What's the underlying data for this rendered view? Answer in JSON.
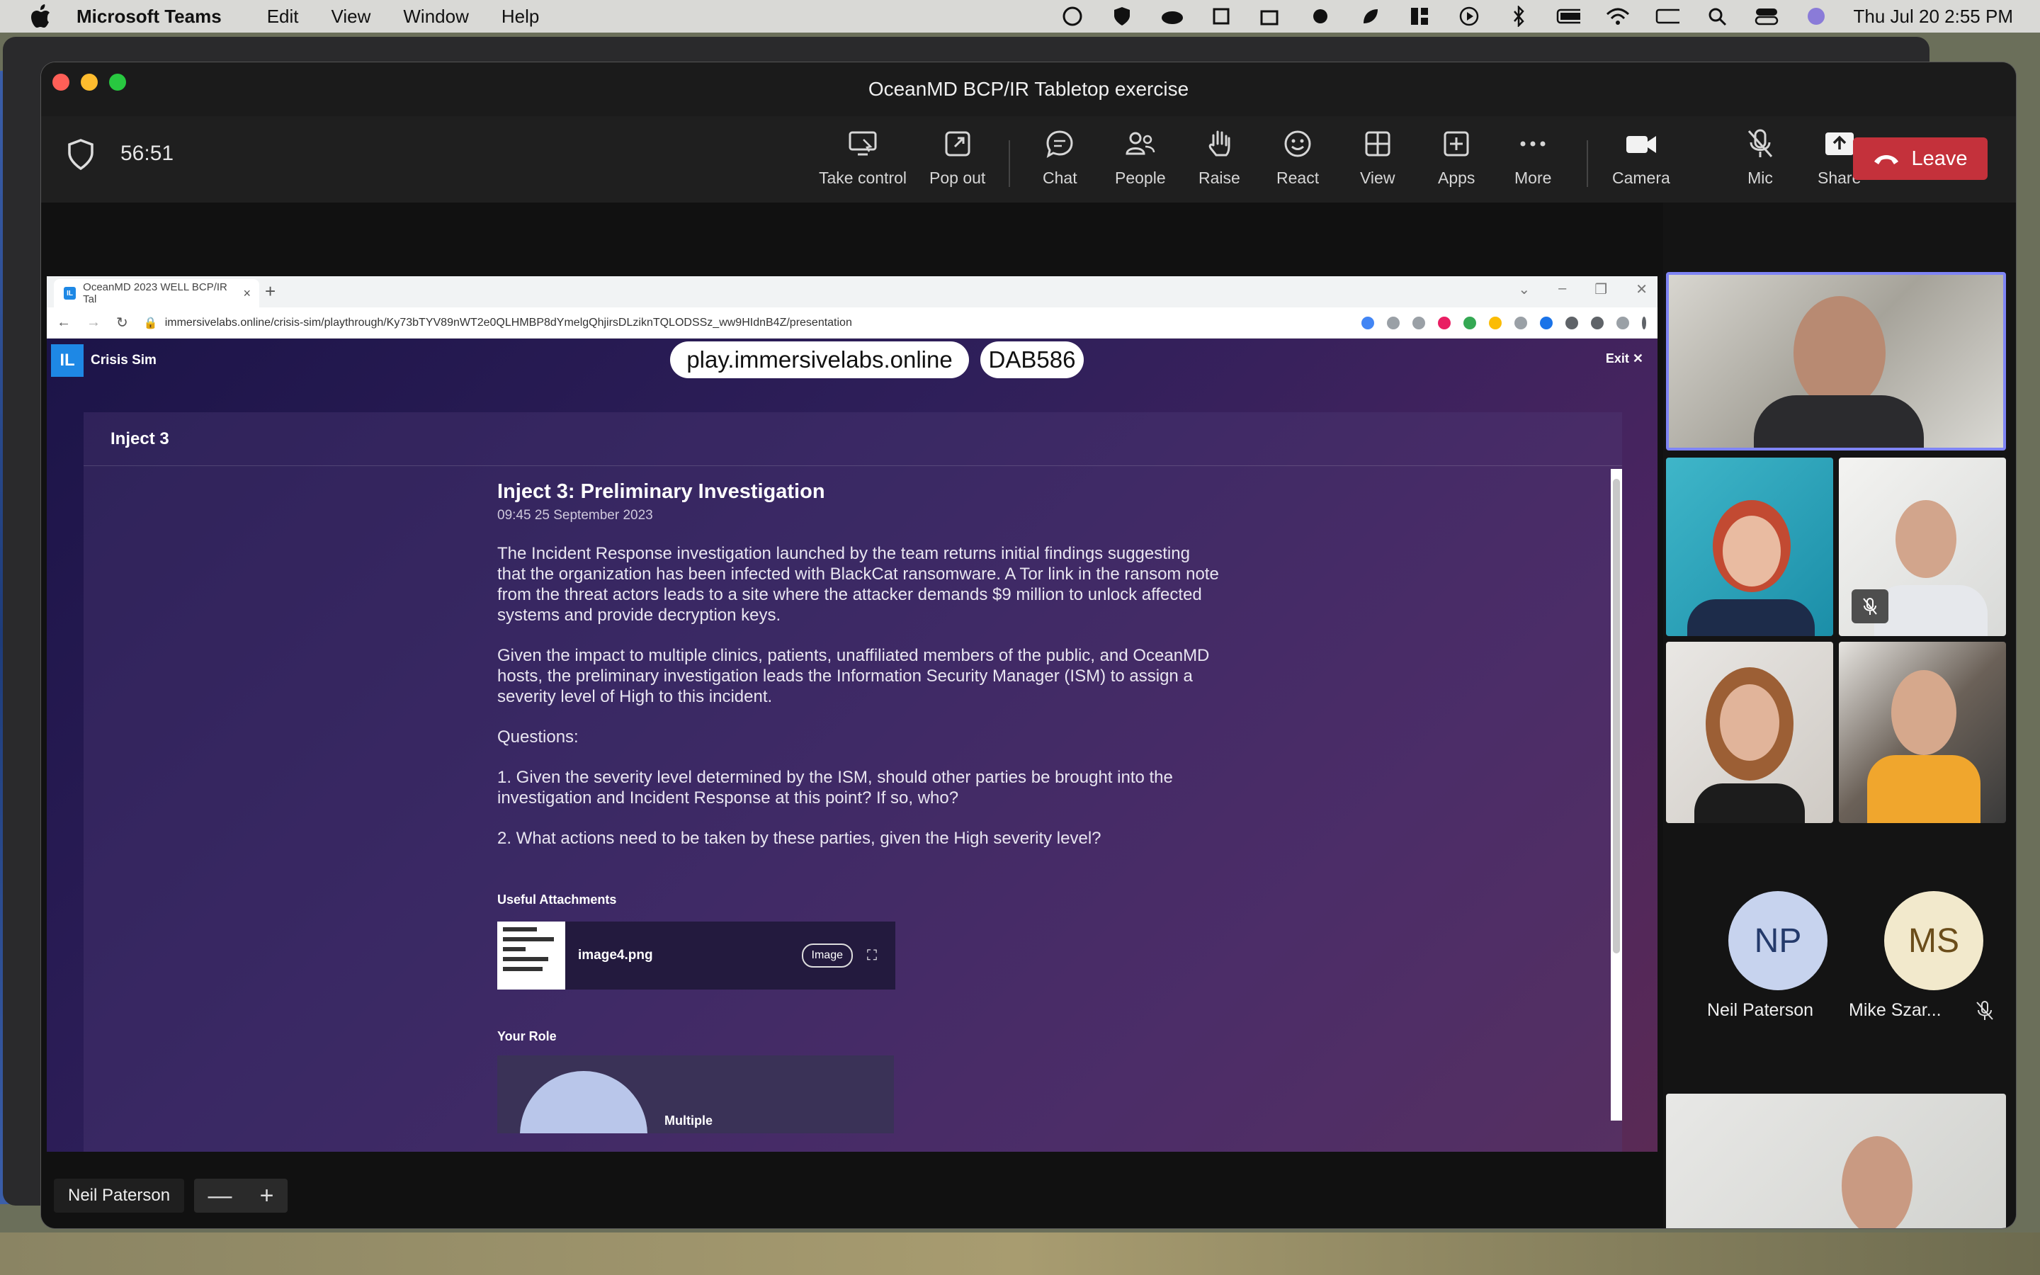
{
  "menubar": {
    "app": "Microsoft Teams",
    "items": [
      "Edit",
      "View",
      "Window",
      "Help"
    ],
    "clock": "Thu Jul 20  2:55 PM"
  },
  "window": {
    "title": "OceanMD BCP/IR Tabletop exercise"
  },
  "toolbar": {
    "timer": "56:51",
    "take_control": "Take control",
    "pop_out": "Pop out",
    "chat": "Chat",
    "people": "People",
    "raise": "Raise",
    "react": "React",
    "view": "View",
    "apps": "Apps",
    "more": "More",
    "camera": "Camera",
    "mic": "Mic",
    "share": "Share",
    "leave": "Leave"
  },
  "browser": {
    "tab_title": "OceanMD 2023 WELL BCP/IR Tal",
    "url": "immersivelabs.online/crisis-sim/playthrough/Ky73bTYV89nWT2e0QLHMBP8dYmelgQhjirsDLziknTQLODSSz_ww9HIdnB4Z/presentation"
  },
  "app": {
    "logo": "IL",
    "name": "Crisis Sim",
    "site": "play.immersivelabs.online",
    "code": "DAB586",
    "exit": "Exit ✕",
    "panel_title": "Inject 3",
    "inject_title": "Inject 3: Preliminary Investigation",
    "inject_date": "09:45  25 September 2023",
    "p1": "The Incident Response investigation launched by the team returns initial findings suggesting that the organization has been infected with BlackCat ransomware. A Tor link in the ransom note from the threat actors leads to a site where the attacker demands $9 million to unlock affected systems and provide decryption keys.",
    "p2": "Given the impact to multiple clinics, patients, unaffiliated members of the public, and OceanMD hosts, the preliminary investigation leads the Information Security Manager (ISM) to assign a severity level of High to this incident.",
    "questions": "Questions:",
    "q1": "1. Given the severity level determined by the ISM, should other parties be brought into the investigation and Incident Response at this point? If so, who?",
    "q2": "2. What actions need to be taken by these parties, given the High severity level?",
    "attachments_label": "Useful Attachments",
    "attachment_name": "image4.png",
    "attachment_type": "Image",
    "role_label": "Your Role",
    "role_text": "Multiple"
  },
  "stage": {
    "presenter": "Neil Paterson",
    "zoom_out": "—",
    "zoom_in": "+"
  },
  "participants": {
    "np_initials": "NP",
    "np_name": "Neil Paterson",
    "ms_initials": "MS",
    "ms_name": "Mike Szar..."
  },
  "colors": {
    "leave": "#c4313b",
    "active_speaker": "#7f85f5",
    "np_avatar": "#c7d3ee",
    "ms_avatar": "#f2e9cc"
  }
}
